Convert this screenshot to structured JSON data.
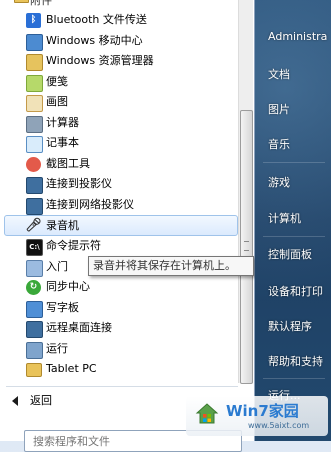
{
  "folder_header": {
    "label": "附件"
  },
  "menu_items": [
    {
      "label": "Bluetooth 文件传送",
      "icon": "bluetooth-icon"
    },
    {
      "label": "Windows 移动中心",
      "icon": "mobility-center-icon"
    },
    {
      "label": "Windows 资源管理器",
      "icon": "explorer-folder-icon"
    },
    {
      "label": "便笺",
      "icon": "sticky-notes-icon"
    },
    {
      "label": "画图",
      "icon": "paint-icon"
    },
    {
      "label": "计算器",
      "icon": "calculator-icon"
    },
    {
      "label": "记事本",
      "icon": "notepad-icon"
    },
    {
      "label": "截图工具",
      "icon": "snipping-tool-icon"
    },
    {
      "label": "连接到投影仪",
      "icon": "projector-icon"
    },
    {
      "label": "连接到网络投影仪",
      "icon": "network-projector-icon"
    },
    {
      "label": "录音机",
      "icon": "microphone-icon"
    },
    {
      "label": "命令提示符",
      "icon": "command-prompt-icon"
    },
    {
      "label": "入门",
      "icon": "getting-started-icon"
    },
    {
      "label": "同步中心",
      "icon": "sync-center-icon"
    },
    {
      "label": "写字板",
      "icon": "wordpad-icon"
    },
    {
      "label": "远程桌面连接",
      "icon": "remote-desktop-icon"
    },
    {
      "label": "运行",
      "icon": "run-icon"
    },
    {
      "label": "Tablet PC",
      "icon": "folder-icon"
    }
  ],
  "selected_item": "录音机",
  "tooltip": "录音并将其保存在计算机上。",
  "back": {
    "label": "返回"
  },
  "search": {
    "placeholder": "搜索程序和文件"
  },
  "right_panel": {
    "items": [
      "Administra",
      "文档",
      "图片",
      "音乐",
      "游戏",
      "计算机",
      "控制面板",
      "设备和打印",
      "默认程序",
      "帮助和支持",
      "运行..."
    ]
  },
  "watermark": {
    "title": "Win7家园",
    "url": "www.5aixt.com"
  },
  "colors": {
    "right_panel": "#22496e",
    "selection": "#dbeafd",
    "selection_border": "#9fc3ea",
    "watermark_blue": "#2b7bd0"
  }
}
